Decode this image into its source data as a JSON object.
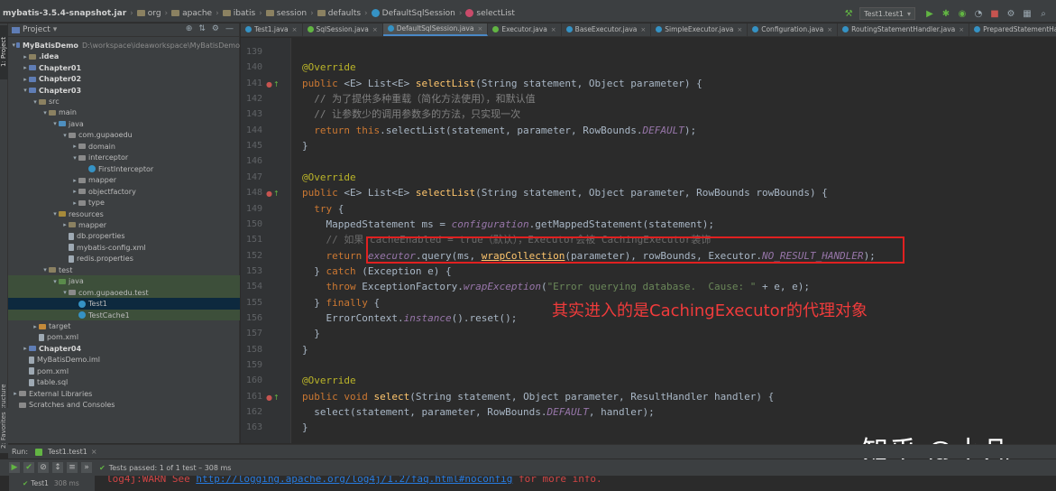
{
  "navbar": {
    "crumbs": [
      "mybatis-3.5.4-snapshot.jar",
      "org",
      "apache",
      "ibatis",
      "session",
      "defaults",
      "DefaultSqlSession",
      "selectList"
    ],
    "run_config": "Test1.test1"
  },
  "left_strip": {
    "tabs": [
      "1: Project",
      "2: Structure",
      "2: Favorites"
    ]
  },
  "project": {
    "header": "Project",
    "tree": [
      {
        "label": "MyBatisDemo",
        "extra": "D:\\workspace\\ideaworkspace\\MyBatisDemo",
        "indent": 0,
        "icon": "mod",
        "arrow": "▾",
        "bold": true
      },
      {
        "label": ".idea",
        "indent": 1,
        "icon": "folder",
        "arrow": "▸",
        "bold": true
      },
      {
        "label": "Chapter01",
        "indent": 1,
        "icon": "mod",
        "arrow": "▸",
        "bold": true
      },
      {
        "label": "Chapter02",
        "indent": 1,
        "icon": "mod",
        "arrow": "▸",
        "bold": true
      },
      {
        "label": "Chapter03",
        "indent": 1,
        "icon": "mod",
        "arrow": "▾",
        "bold": true
      },
      {
        "label": "src",
        "indent": 2,
        "icon": "folder",
        "arrow": "▾"
      },
      {
        "label": "main",
        "indent": 3,
        "icon": "folder",
        "arrow": "▾"
      },
      {
        "label": "java",
        "indent": 4,
        "icon": "src",
        "arrow": "▾"
      },
      {
        "label": "com.gupaoedu",
        "indent": 5,
        "icon": "pkg",
        "arrow": "▾"
      },
      {
        "label": "domain",
        "indent": 6,
        "icon": "pkg",
        "arrow": "▸"
      },
      {
        "label": "interceptor",
        "indent": 6,
        "icon": "pkg",
        "arrow": "▾"
      },
      {
        "label": "FirstInterceptor",
        "indent": 7,
        "icon": "cls",
        "arrow": ""
      },
      {
        "label": "mapper",
        "indent": 6,
        "icon": "pkg",
        "arrow": "▸"
      },
      {
        "label": "objectfactory",
        "indent": 6,
        "icon": "pkg",
        "arrow": "▸"
      },
      {
        "label": "type",
        "indent": 6,
        "icon": "pkg",
        "arrow": "▸"
      },
      {
        "label": "resources",
        "indent": 4,
        "icon": "res",
        "arrow": "▾"
      },
      {
        "label": "mapper",
        "indent": 5,
        "icon": "folder",
        "arrow": "▸"
      },
      {
        "label": "db.properties",
        "indent": 5,
        "icon": "file",
        "arrow": ""
      },
      {
        "label": "mybatis-config.xml",
        "indent": 5,
        "icon": "file",
        "arrow": ""
      },
      {
        "label": "redis.properties",
        "indent": 5,
        "icon": "file",
        "arrow": ""
      },
      {
        "label": "test",
        "indent": 3,
        "icon": "folder",
        "arrow": "▾"
      },
      {
        "label": "java",
        "indent": 4,
        "icon": "test",
        "arrow": "▾",
        "hl": true
      },
      {
        "label": "com.gupaoedu.test",
        "indent": 5,
        "icon": "pkg",
        "arrow": "▾",
        "hl": true
      },
      {
        "label": "Test1",
        "indent": 6,
        "icon": "cls",
        "arrow": "",
        "sel": true
      },
      {
        "label": "TestCache1",
        "indent": 6,
        "icon": "cls",
        "arrow": "",
        "hl": true
      },
      {
        "label": "target",
        "indent": 2,
        "icon": "excl",
        "arrow": "▸"
      },
      {
        "label": "pom.xml",
        "indent": 2,
        "icon": "file",
        "arrow": ""
      },
      {
        "label": "Chapter04",
        "indent": 1,
        "icon": "mod",
        "arrow": "▸",
        "bold": true
      },
      {
        "label": "MyBatisDemo.iml",
        "indent": 1,
        "icon": "file",
        "arrow": ""
      },
      {
        "label": "pom.xml",
        "indent": 1,
        "icon": "file",
        "arrow": ""
      },
      {
        "label": "table.sql",
        "indent": 1,
        "icon": "file",
        "arrow": ""
      },
      {
        "label": "External Libraries",
        "indent": 0,
        "icon": "pkg",
        "arrow": "▸"
      },
      {
        "label": "Scratches and Consoles",
        "indent": 0,
        "icon": "pkg",
        "arrow": ""
      }
    ]
  },
  "tabs": [
    {
      "label": "Test1.java",
      "icon": "class"
    },
    {
      "label": "SqlSession.java",
      "icon": "iface"
    },
    {
      "label": "DefaultSqlSession.java",
      "icon": "class",
      "active": true
    },
    {
      "label": "Executor.java",
      "icon": "iface"
    },
    {
      "label": "BaseExecutor.java",
      "icon": "class"
    },
    {
      "label": "SimpleExecutor.java",
      "icon": "class"
    },
    {
      "label": "Configuration.java",
      "icon": "class"
    },
    {
      "label": "RoutingStatementHandler.java",
      "icon": "class"
    },
    {
      "label": "PreparedStatementHandler",
      "icon": "class"
    }
  ],
  "gutter": {
    "line_numbers": [
      "139",
      "140",
      "141",
      "142",
      "143",
      "144",
      "145",
      "146",
      "147",
      "148",
      "149",
      "150",
      "151",
      "152",
      "153",
      "154",
      "155",
      "156",
      "157",
      "158",
      "159",
      "160",
      "161",
      "162",
      "163"
    ]
  },
  "code_lines": [
    [],
    [
      {
        "t": "@Override",
        "c": "ann"
      }
    ],
    [
      {
        "t": "public ",
        "c": "kw"
      },
      {
        "t": "<E> List<E> "
      },
      {
        "t": "selectList",
        "c": "fn"
      },
      {
        "t": "(String statement, Object parameter) {"
      }
    ],
    [
      {
        "t": "  // 为了提供多种重载（简化方法使用），和默认值",
        "c": "cm"
      }
    ],
    [
      {
        "t": "  // 让参数少的调用参数多的方法，只实现一次",
        "c": "cm"
      }
    ],
    [
      {
        "t": "  "
      },
      {
        "t": "return this",
        "c": "kw"
      },
      {
        "t": ".selectList(statement, parameter, RowBounds."
      },
      {
        "t": "DEFAULT",
        "c": "it"
      },
      {
        "t": ");"
      }
    ],
    [
      {
        "t": "}"
      }
    ],
    [],
    [
      {
        "t": "@Override",
        "c": "ann"
      }
    ],
    [
      {
        "t": "public ",
        "c": "kw"
      },
      {
        "t": "<E> List<E> "
      },
      {
        "t": "selectList",
        "c": "fn"
      },
      {
        "t": "(String statement, Object parameter, RowBounds rowBounds) {"
      }
    ],
    [
      {
        "t": "  "
      },
      {
        "t": "try ",
        "c": "kw"
      },
      {
        "t": "{"
      }
    ],
    [
      {
        "t": "    MappedStatement ms = "
      },
      {
        "t": "configuration",
        "c": "it"
      },
      {
        "t": ".getMappedStatement(statement);"
      }
    ],
    [
      {
        "t": "    // 如果 cacheEnabled = true（默认），Executor会被 CachingExecutor装饰",
        "c": "cmz"
      }
    ],
    [
      {
        "t": "    "
      },
      {
        "t": "return ",
        "c": "kw"
      },
      {
        "t": "executor",
        "c": "it"
      },
      {
        "t": ".query(ms, "
      },
      {
        "t": "wrapCollection",
        "c": "fn ul"
      },
      {
        "t": "(parameter), rowBounds, Executor."
      },
      {
        "t": "NO_RESULT_HANDLER",
        "c": "it"
      },
      {
        "t": ");"
      }
    ],
    [
      {
        "t": "  } "
      },
      {
        "t": "catch ",
        "c": "kw"
      },
      {
        "t": "(Exception e) {"
      }
    ],
    [
      {
        "t": "    "
      },
      {
        "t": "throw ",
        "c": "kw"
      },
      {
        "t": "ExceptionFactory."
      },
      {
        "t": "wrapException",
        "c": "it"
      },
      {
        "t": "("
      },
      {
        "t": "\"Error querying database.  Cause: \"",
        "c": "st"
      },
      {
        "t": " + e, e);"
      }
    ],
    [
      {
        "t": "  } "
      },
      {
        "t": "finally ",
        "c": "kw"
      },
      {
        "t": "{"
      }
    ],
    [
      {
        "t": "    ErrorContext."
      },
      {
        "t": "instance",
        "c": "it"
      },
      {
        "t": "().reset();"
      }
    ],
    [
      {
        "t": "  }"
      }
    ],
    [
      {
        "t": "}"
      }
    ],
    [],
    [
      {
        "t": "@Override",
        "c": "ann"
      }
    ],
    [
      {
        "t": "public void ",
        "c": "kw"
      },
      {
        "t": "select",
        "c": "fn"
      },
      {
        "t": "(String statement, Object parameter, ResultHandler handler) {"
      }
    ],
    [
      {
        "t": "  select(statement, parameter, RowBounds."
      },
      {
        "t": "DEFAULT",
        "c": "it"
      },
      {
        "t": ", handler);"
      }
    ],
    [
      {
        "t": "}"
      }
    ]
  ],
  "annotation_note": "其实进入的是CachingExecutor的代理对象",
  "watermark": "知乎 @小凡",
  "run_bar": {
    "label": "Run:",
    "config": "Test1.test1"
  },
  "status_bar": {
    "tests_passed": "Tests passed: 1 of 1 test – 308 ms"
  },
  "console": {
    "test_item": "Test1",
    "test_time": "308 ms",
    "prefix": "log4j:WARN See ",
    "link": "http://logging.apache.org/log4j/1.2/faq.html#noconfig",
    "suffix": " for more info."
  }
}
